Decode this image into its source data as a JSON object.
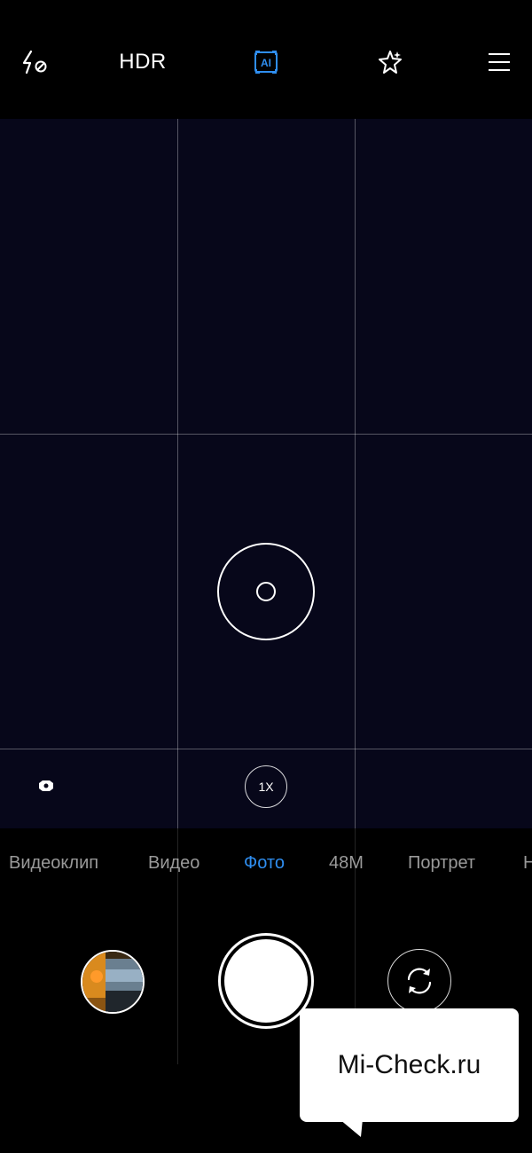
{
  "topbar": {
    "flash_icon": "flash-off-icon",
    "hdr_label": "HDR",
    "ai_label": "AI",
    "ai_color": "#2f8ef0",
    "star_icon": "beauty-star-icon",
    "menu_icon": "menu-icon"
  },
  "viewfinder": {
    "zoom_label": "1X",
    "lens_icon": "ultrawide-lens-icon"
  },
  "modes": {
    "items": [
      {
        "label": "Видеоклип"
      },
      {
        "label": "Видео"
      },
      {
        "label": "Фото",
        "active": true
      },
      {
        "label": "48M"
      },
      {
        "label": "Портрет"
      },
      {
        "label": "Н"
      }
    ],
    "active_color": "#2f8ef0",
    "inactive_color": "#9a9a9a"
  },
  "controls": {
    "gallery_icon": "gallery-thumbnail",
    "shutter_icon": "shutter-button",
    "switch_icon": "switch-camera-icon"
  },
  "watermark": {
    "text": "Mi-Check.ru"
  }
}
